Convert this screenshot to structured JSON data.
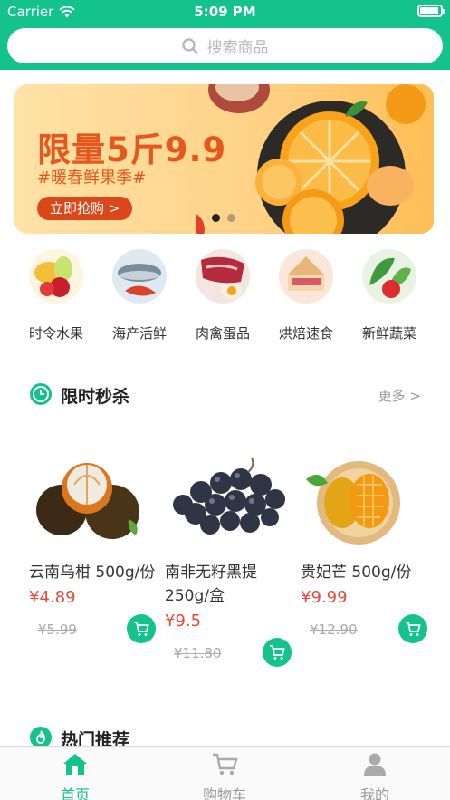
{
  "status_bar": {
    "carrier": "Carrier",
    "time": "5:09 PM"
  },
  "search": {
    "placeholder": "搜索商品"
  },
  "banner": {
    "title": "限量5斤9.9",
    "subtitle": "#暖春鲜果季#",
    "button": "立即抢购 >",
    "page_count": 2,
    "active_page": 1
  },
  "categories": [
    {
      "label": "时令水果",
      "icon": "fruit-icon"
    },
    {
      "label": "海产活鲜",
      "icon": "seafood-icon"
    },
    {
      "label": "肉禽蛋品",
      "icon": "meat-egg-icon"
    },
    {
      "label": "烘焙速食",
      "icon": "bakery-icon"
    },
    {
      "label": "新鲜蔬菜",
      "icon": "vegetable-icon"
    }
  ],
  "flash_sale": {
    "title": "限时秒杀",
    "more": "更多 >",
    "products": [
      {
        "name": "云南乌柑 500g/份",
        "price": "¥4.89",
        "original_price": "¥5.99"
      },
      {
        "name": "南非无籽黑提250g/盒",
        "price": "¥9.5",
        "original_price": "¥11.80"
      },
      {
        "name": "贵妃芒 500g/份",
        "price": "¥9.99",
        "original_price": "¥12.90"
      }
    ]
  },
  "hot": {
    "title": "热门推荐"
  },
  "tabbar": {
    "tabs": [
      {
        "label": "首页",
        "icon": "home-icon",
        "active": true
      },
      {
        "label": "购物车",
        "icon": "cart-icon",
        "active": false
      },
      {
        "label": "我的",
        "icon": "user-icon",
        "active": false
      }
    ]
  },
  "colors": {
    "brand": "#13c38b",
    "price": "#e64a3c",
    "banner_text": "#e5571d"
  }
}
